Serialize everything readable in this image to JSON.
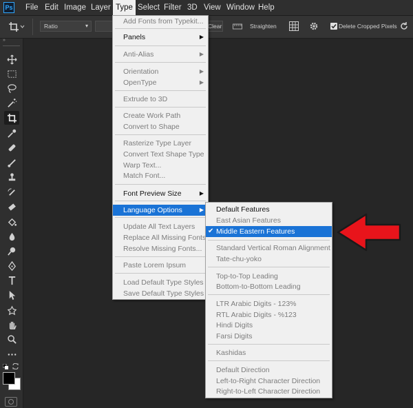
{
  "app": {
    "logo_text": "Ps"
  },
  "menubar": {
    "items": [
      "File",
      "Edit",
      "Image",
      "Layer",
      "Type",
      "Select",
      "Filter",
      "3D",
      "View",
      "Window",
      "Help"
    ],
    "active": "Type"
  },
  "options": {
    "ratio_label": "Ratio",
    "clear_label": "Clear",
    "straighten_label": "Straighten",
    "delete_cropped_label": "Delete Cropped Pixels",
    "delete_cropped_checked": true
  },
  "type_menu": {
    "items": [
      {
        "label": "Add Fonts from Typekit...",
        "enabled": false,
        "submenu": false
      },
      {
        "label": "Panels",
        "enabled": true,
        "submenu": true
      },
      {
        "label": "Anti-Alias",
        "enabled": false,
        "submenu": true
      },
      {
        "label": "Orientation",
        "enabled": false,
        "submenu": true
      },
      {
        "label": "OpenType",
        "enabled": false,
        "submenu": true
      },
      {
        "label": "Extrude to 3D",
        "enabled": false,
        "submenu": false
      },
      {
        "label": "Create Work Path",
        "enabled": false,
        "submenu": false
      },
      {
        "label": "Convert to Shape",
        "enabled": false,
        "submenu": false
      },
      {
        "label": "Rasterize Type Layer",
        "enabled": false,
        "submenu": false
      },
      {
        "label": "Convert Text Shape Type",
        "enabled": false,
        "submenu": false
      },
      {
        "label": "Warp Text...",
        "enabled": false,
        "submenu": false
      },
      {
        "label": "Match Font...",
        "enabled": false,
        "submenu": false
      },
      {
        "label": "Font Preview Size",
        "enabled": true,
        "submenu": true
      },
      {
        "label": "Language Options",
        "enabled": true,
        "submenu": true,
        "highlighted": true
      },
      {
        "label": "Update All Text Layers",
        "enabled": false,
        "submenu": false
      },
      {
        "label": "Replace All Missing Fonts",
        "enabled": false,
        "submenu": false
      },
      {
        "label": "Resolve Missing Fonts...",
        "enabled": false,
        "submenu": false
      },
      {
        "label": "Paste Lorem Ipsum",
        "enabled": false,
        "submenu": false
      },
      {
        "label": "Load Default Type Styles",
        "enabled": false,
        "submenu": false
      },
      {
        "label": "Save Default Type Styles",
        "enabled": false,
        "submenu": false
      }
    ]
  },
  "language_submenu": {
    "items": [
      {
        "label": "Default Features",
        "enabled": true
      },
      {
        "label": "East Asian Features",
        "enabled": false
      },
      {
        "label": "Middle Eastern Features",
        "enabled": true,
        "checked": true,
        "highlighted": true
      },
      {
        "label": "Standard Vertical Roman Alignment",
        "enabled": false
      },
      {
        "label": "Tate-chu-yoko",
        "enabled": false
      },
      {
        "label": "Top-to-Top Leading",
        "enabled": false
      },
      {
        "label": "Bottom-to-Bottom Leading",
        "enabled": false
      },
      {
        "label": "LTR Arabic Digits - 123%",
        "enabled": false
      },
      {
        "label": "RTL Arabic Digits - %123",
        "enabled": false
      },
      {
        "label": "Hindi Digits",
        "enabled": false
      },
      {
        "label": "Farsi Digits",
        "enabled": false
      },
      {
        "label": "Kashidas",
        "enabled": false
      },
      {
        "label": "Default Direction",
        "enabled": false
      },
      {
        "label": "Left-to-Right Character Direction",
        "enabled": false
      },
      {
        "label": "Right-to-Left Character Direction",
        "enabled": false
      }
    ]
  },
  "annotation": {
    "arrow_color": "#e8141b"
  },
  "colors": {
    "highlight": "#1a73d6",
    "foreground": "#000000",
    "background": "#ffffff"
  },
  "tools": [
    "move-icon",
    "marquee-icon",
    "lasso-icon",
    "magic-wand-icon",
    "crop-icon",
    "eyedropper-icon",
    "healing-brush-icon",
    "brush-icon",
    "clone-stamp-icon",
    "history-brush-icon",
    "eraser-icon",
    "paint-bucket-icon",
    "blur-icon",
    "dodge-icon",
    "pen-icon",
    "type-icon",
    "path-selection-icon",
    "custom-shape-icon",
    "hand-icon",
    "zoom-icon",
    "more-tools-icon"
  ]
}
